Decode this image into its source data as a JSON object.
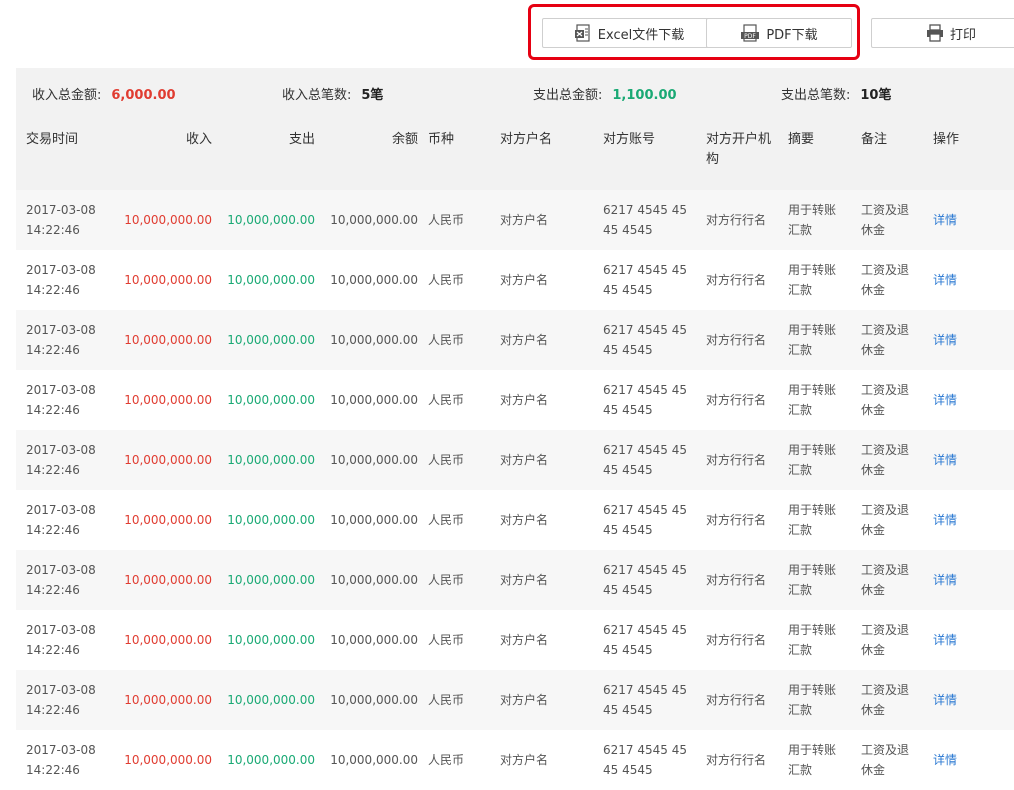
{
  "toolbar": {
    "excel_label": "Excel文件下载",
    "pdf_label": "PDF下载",
    "print_label": "打印",
    "excel_icon": "excel-file-icon",
    "pdf_icon": "pdf-file-icon",
    "print_icon": "printer-icon",
    "highlight_color": "#e60012"
  },
  "summary": {
    "income_total_label": "收入总金额:",
    "income_total_value": "6,000.00",
    "income_count_label": "收入总笔数:",
    "income_count_value": "5笔",
    "expense_total_label": "支出总金额:",
    "expense_total_value": "1,100.00",
    "expense_count_label": "支出总笔数:",
    "expense_count_value": "10笔"
  },
  "table": {
    "columns": [
      "交易时间",
      "收入",
      "支出",
      "余额",
      "币种",
      "对方户名",
      "对方账号",
      "对方开户机构",
      "摘要",
      "备注",
      "操作"
    ],
    "rows": [
      {
        "date": "2017-03-08",
        "time": "14:22:46",
        "income": "10,000,000.00",
        "expense": "10,000,000.00",
        "balance": "10,000,000.00",
        "currency": "人民币",
        "name": "对方户名",
        "account": "6217 4545 45 45 4545",
        "bank": "对方行行名",
        "summary": "用于转账汇款",
        "remark": "工资及退休金",
        "action": "详情"
      },
      {
        "date": "2017-03-08",
        "time": "14:22:46",
        "income": "10,000,000.00",
        "expense": "10,000,000.00",
        "balance": "10,000,000.00",
        "currency": "人民币",
        "name": "对方户名",
        "account": "6217 4545 45 45 4545",
        "bank": "对方行行名",
        "summary": "用于转账汇款",
        "remark": "工资及退休金",
        "action": "详情"
      },
      {
        "date": "2017-03-08",
        "time": "14:22:46",
        "income": "10,000,000.00",
        "expense": "10,000,000.00",
        "balance": "10,000,000.00",
        "currency": "人民币",
        "name": "对方户名",
        "account": "6217 4545 45 45 4545",
        "bank": "对方行行名",
        "summary": "用于转账汇款",
        "remark": "工资及退休金",
        "action": "详情"
      },
      {
        "date": "2017-03-08",
        "time": "14:22:46",
        "income": "10,000,000.00",
        "expense": "10,000,000.00",
        "balance": "10,000,000.00",
        "currency": "人民币",
        "name": "对方户名",
        "account": "6217 4545 45 45 4545",
        "bank": "对方行行名",
        "summary": "用于转账汇款",
        "remark": "工资及退休金",
        "action": "详情"
      },
      {
        "date": "2017-03-08",
        "time": "14:22:46",
        "income": "10,000,000.00",
        "expense": "10,000,000.00",
        "balance": "10,000,000.00",
        "currency": "人民币",
        "name": "对方户名",
        "account": "6217 4545 45 45 4545",
        "bank": "对方行行名",
        "summary": "用于转账汇款",
        "remark": "工资及退休金",
        "action": "详情"
      },
      {
        "date": "2017-03-08",
        "time": "14:22:46",
        "income": "10,000,000.00",
        "expense": "10,000,000.00",
        "balance": "10,000,000.00",
        "currency": "人民币",
        "name": "对方户名",
        "account": "6217 4545 45 45 4545",
        "bank": "对方行行名",
        "summary": "用于转账汇款",
        "remark": "工资及退休金",
        "action": "详情"
      },
      {
        "date": "2017-03-08",
        "time": "14:22:46",
        "income": "10,000,000.00",
        "expense": "10,000,000.00",
        "balance": "10,000,000.00",
        "currency": "人民币",
        "name": "对方户名",
        "account": "6217 4545 45 45 4545",
        "bank": "对方行行名",
        "summary": "用于转账汇款",
        "remark": "工资及退休金",
        "action": "详情"
      },
      {
        "date": "2017-03-08",
        "time": "14:22:46",
        "income": "10,000,000.00",
        "expense": "10,000,000.00",
        "balance": "10,000,000.00",
        "currency": "人民币",
        "name": "对方户名",
        "account": "6217 4545 45 45 4545",
        "bank": "对方行行名",
        "summary": "用于转账汇款",
        "remark": "工资及退休金",
        "action": "详情"
      },
      {
        "date": "2017-03-08",
        "time": "14:22:46",
        "income": "10,000,000.00",
        "expense": "10,000,000.00",
        "balance": "10,000,000.00",
        "currency": "人民币",
        "name": "对方户名",
        "account": "6217 4545 45 45 4545",
        "bank": "对方行行名",
        "summary": "用于转账汇款",
        "remark": "工资及退休金",
        "action": "详情"
      },
      {
        "date": "2017-03-08",
        "time": "14:22:46",
        "income": "10,000,000.00",
        "expense": "10,000,000.00",
        "balance": "10,000,000.00",
        "currency": "人民币",
        "name": "对方户名",
        "account": "6217 4545 45 45 4545",
        "bank": "对方行行名",
        "summary": "用于转账汇款",
        "remark": "工资及退休金",
        "action": "详情"
      }
    ]
  },
  "colors": {
    "income": "#e03c31",
    "expense": "#19a974",
    "link": "#2a78d2",
    "header_bg": "#f2f2f2"
  }
}
